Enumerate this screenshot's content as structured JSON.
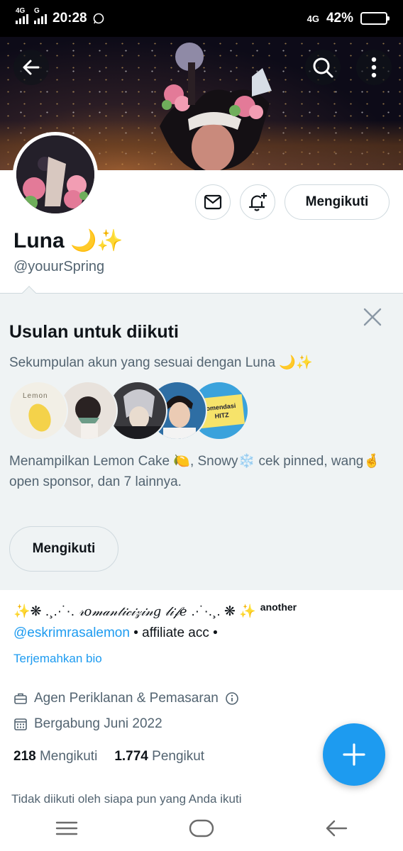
{
  "status_bar": {
    "net1": "4G",
    "net2": "G",
    "time": "20:28",
    "net3": "4G",
    "battery": "42%",
    "battery_level": 0.42,
    "battery_color": "#f6c12e"
  },
  "profile": {
    "name": "Luna 🌙✨",
    "handle": "@youurSpring",
    "following_button": "Mengikuti"
  },
  "suggestions": {
    "title": "Usulan untuk diikuti",
    "subtitle": "Sekumpulan akun yang sesuai dengan Luna 🌙✨",
    "avatars": [
      {
        "label": "Lemon"
      },
      {
        "label": ""
      },
      {
        "label": ""
      },
      {
        "label": ""
      },
      {
        "label": "omendasi HITZ"
      }
    ],
    "description": "Menampilkan Lemon Cake 🍋, Snowy❄️ cek pinned, wang🤞open sponsor, dan 7 lainnya.",
    "follow_button": "Mengikuti"
  },
  "bio": {
    "line1_prefix": "✨❋ .¸.·˙·.",
    "line1_script": "𝓇𝑜𝓂𝒶𝓃𝓉𝒾𝒸𝒾𝓏𝒾𝓃𝑔 𝓁𝒾𝒻𝑒",
    "line1_suffix": ".·˙·.¸. ❋ ✨",
    "line1_tail": "another",
    "mention": "@eskrimrasalemon",
    "line2_rest": " • affiliate acc •",
    "translate": "Terjemahkan bio"
  },
  "info": {
    "category": "Agen Periklanan & Pemasaran",
    "joined": "Bergabung Juni 2022"
  },
  "counts": {
    "following_num": "218",
    "following_label": "Mengikuti",
    "followers_num": "1.774",
    "followers_label": "Pengikut"
  },
  "footer_note": "Tidak diikuti oleh siapa pun yang Anda ikuti",
  "accent_color": "#1d9bf0"
}
